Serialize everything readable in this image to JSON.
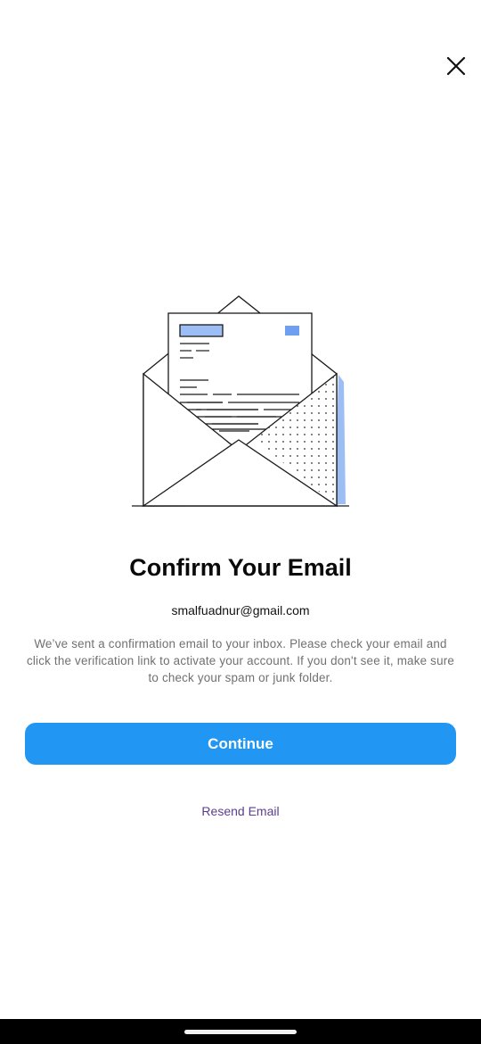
{
  "header": {
    "close_icon": "close-icon"
  },
  "illustration": {
    "icon": "open-envelope-with-letter-icon",
    "accent_color": "#9dbef5",
    "line_color": "#1a1a1a"
  },
  "main": {
    "title": "Confirm Your Email",
    "email": "smalfuadnur@gmail.com",
    "description": "We’ve sent a confirmation email to your inbox. Please check your email and click the verification link to activate your account. If you don't see it, make sure to check your spam or junk folder.",
    "continue_label": "Continue",
    "resend_label": "Resend Email"
  },
  "colors": {
    "primary": "#2196f3",
    "link": "#5b3f8f",
    "description_text": "#707070"
  }
}
